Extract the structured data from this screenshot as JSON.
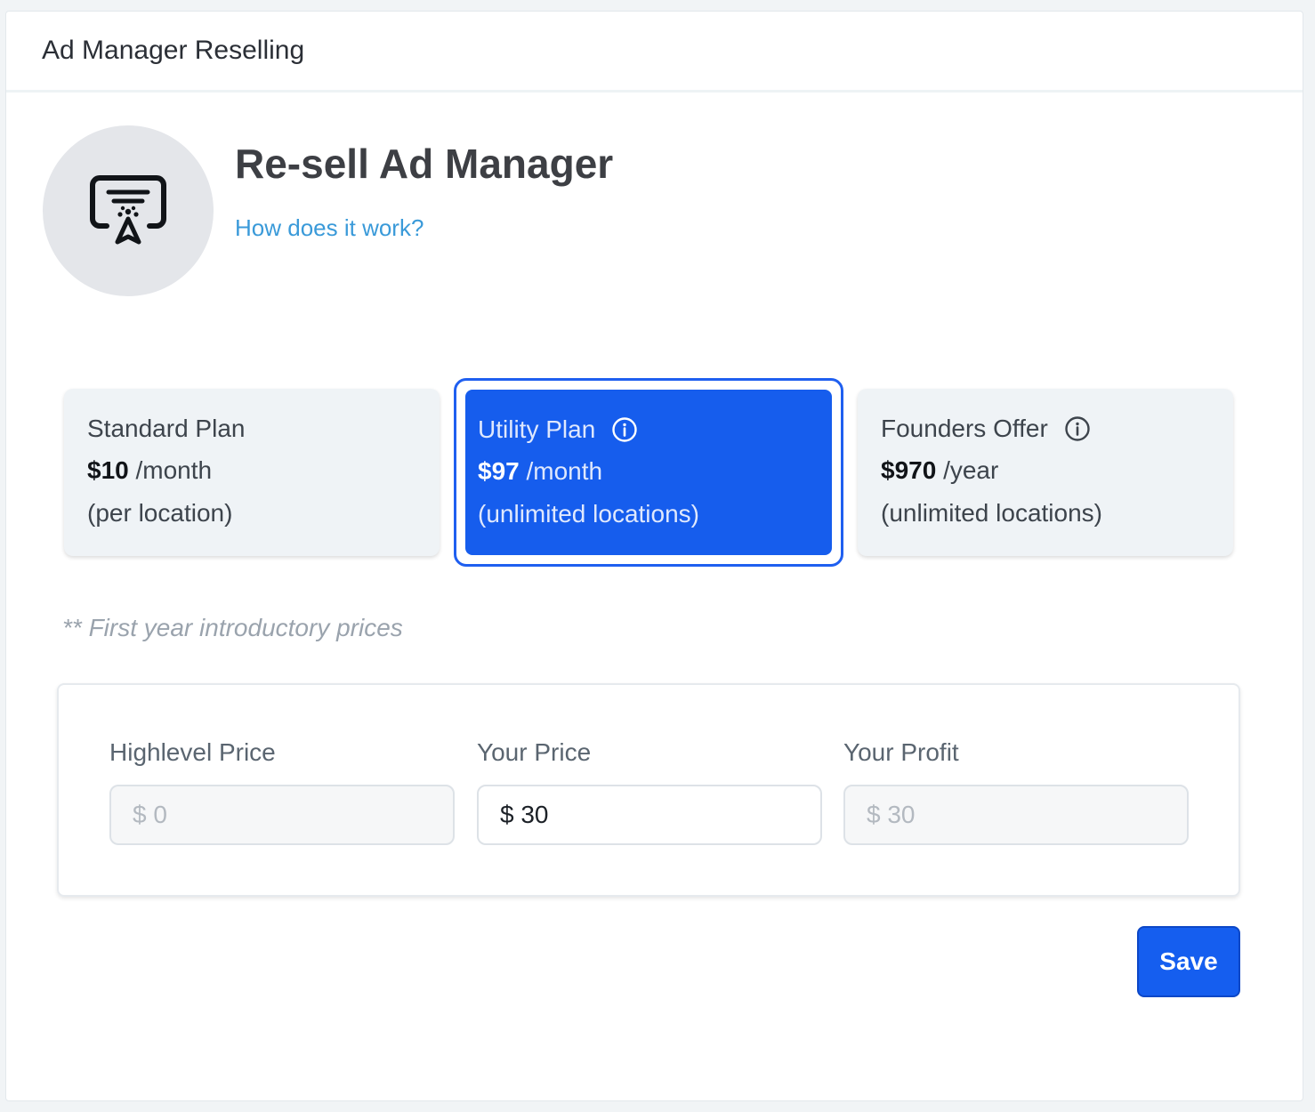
{
  "header": {
    "title": "Ad Manager Reselling"
  },
  "hero": {
    "icon": "ad-manager-icon",
    "title": "Re-sell Ad Manager",
    "help_link": "How does it work?"
  },
  "plans": [
    {
      "name": "Standard Plan",
      "price": "$10",
      "period": "/month",
      "note": "(per location)",
      "has_info": false,
      "selected": false
    },
    {
      "name": "Utility Plan",
      "price": "$97",
      "period": "/month",
      "note": "(unlimited locations)",
      "has_info": true,
      "selected": true
    },
    {
      "name": "Founders Offer",
      "price": "$970",
      "period": "/year",
      "note": "(unlimited locations)",
      "has_info": true,
      "selected": false
    }
  ],
  "intro_note": "** First year introductory prices",
  "pricing": {
    "highlevel": {
      "label": "Highlevel Price",
      "value": "$ 0"
    },
    "yours": {
      "label": "Your Price",
      "value": "$ 30"
    },
    "profit": {
      "label": "Your Profit",
      "value": "$ 30"
    }
  },
  "actions": {
    "save_label": "Save"
  },
  "colors": {
    "accent": "#155eef",
    "link": "#3a9ad9",
    "selected_plan_bg": "#165ded"
  }
}
